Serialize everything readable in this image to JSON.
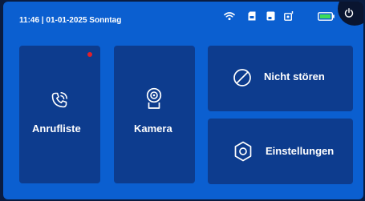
{
  "status_bar": {
    "datetime": "11:46 | 01-01-2025 Sonntag",
    "icons": [
      "wifi-icon",
      "sd-card-icon",
      "storage-icon",
      "door-lock-icon",
      "battery-icon"
    ],
    "battery_color": "#3ddc5a"
  },
  "power": {
    "icon": "power-icon"
  },
  "tiles": {
    "call_list": {
      "label": "Anrufliste",
      "icon": "phone-icon",
      "has_notification": true
    },
    "camera": {
      "label": "Kamera",
      "icon": "camera-icon"
    },
    "do_not_disturb": {
      "label": "Nicht stören",
      "icon": "do-not-disturb-icon"
    },
    "settings": {
      "label": "Einstellungen",
      "icon": "settings-icon"
    }
  },
  "colors": {
    "background": "#0b5fd0",
    "tile": "#0d3c8e",
    "notification": "#e0202a",
    "text": "#ffffff"
  }
}
